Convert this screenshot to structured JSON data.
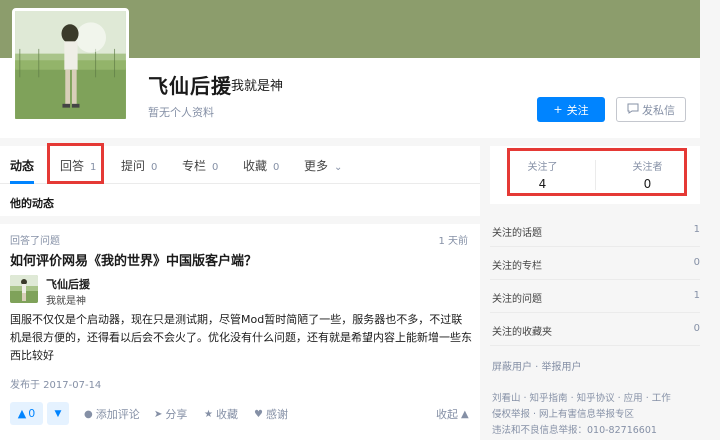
{
  "profile": {
    "name": "飞仙后援",
    "headline": "我就是神",
    "no_profile": "暂无个人资料",
    "follow_button": "关注",
    "message_button": "发私信",
    "follow_icon": "plus-icon",
    "message_icon": "chat-icon"
  },
  "tabs": [
    {
      "label": "动态",
      "count": ""
    },
    {
      "label": "回答",
      "count": "1"
    },
    {
      "label": "提问",
      "count": "0"
    },
    {
      "label": "专栏",
      "count": "0"
    },
    {
      "label": "收藏",
      "count": "0"
    },
    {
      "label": "更多",
      "count": ""
    }
  ],
  "feed": {
    "section_title": "他的动态",
    "item": {
      "meta": "回答了问题",
      "time": "1 天前",
      "question": "如何评价网易《我的世界》中国版客户端？",
      "author_name": "飞仙后援",
      "author_headline": "我就是神",
      "answer": "国服不仅仅是个启动器，现在只是测试期，尽管Mod暂时简陋了一些，服务器也不多，不过联机是很方便的，还得看以后会不会火了。优化没有什么问题，还有就是希望内容上能新增一些东西比较好",
      "published": "发布于 2017-07-14",
      "vote_count": "0",
      "actions": {
        "comment": "添加评论",
        "share": "分享",
        "collect": "收藏",
        "thanks": "感谢",
        "collapse": "收起"
      }
    }
  },
  "sidebar": {
    "following_label": "关注了",
    "following_count": "4",
    "followers_label": "关注者",
    "followers_count": "0",
    "items": [
      {
        "label": "关注的话题",
        "count": "1"
      },
      {
        "label": "关注的专栏",
        "count": "0"
      },
      {
        "label": "关注的问题",
        "count": "1"
      },
      {
        "label": "关注的收藏夹",
        "count": "0"
      }
    ],
    "links": "屏蔽用户 · 举报用户",
    "footer_line1": "刘看山 · 知乎指南 · 知乎协议 · 应用 · 工作",
    "footer_line2": "侵权举报 · 网上有害信息举报专区",
    "footer_line3": "违法和不良信息举报：010-82716601"
  },
  "colors": {
    "accent": "#0084ff",
    "cover": "#8c9d6c",
    "highlight_box": "#e53935"
  }
}
